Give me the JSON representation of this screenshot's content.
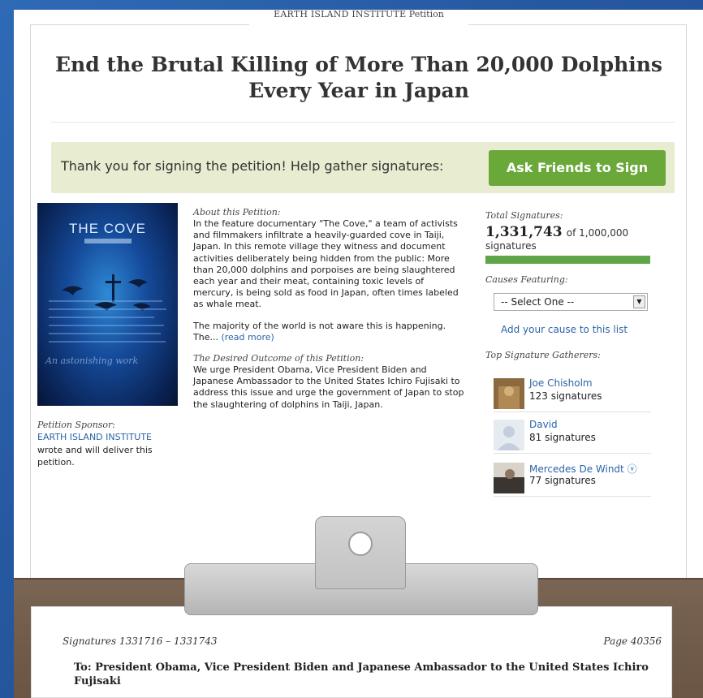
{
  "header": {
    "org": "EARTH ISLAND INSTITUTE",
    "suffix": "Petition"
  },
  "petition": {
    "title": "End the Brutal Killing of More Than 20,000 Dolphins Every Year in Japan",
    "thanks_text": "Thank you for signing the petition! Help gather signatures:",
    "ask_button": "Ask Friends to Sign",
    "poster_title": "THE COVE",
    "poster_tagline": "An astonishing work",
    "sponsor": {
      "label": "Petition Sponsor:",
      "name": "EARTH ISLAND INSTITUTE",
      "desc": "wrote and will deliver this petition."
    },
    "about": {
      "label": "About this Petition:",
      "text": "In the feature documentary \"The Cove,\" a team of activists and filmmakers infiltrate a heavily-guarded cove in Taiji, Japan. In this remote village they witness and document activities deliberately being hidden from the public: More than 20,000 dolphins and porpoises are being slaughtered each year and their meat, containing toxic levels of mercury, is being sold as food in Japan, often times labeled as whale meat.",
      "text2": "The majority of the world is not aware this is happening. The...",
      "read_more": "(read more)"
    },
    "outcome": {
      "label": "The Desired Outcome of this Petition:",
      "text": "We urge President Obama, Vice President Biden and Japanese Ambassador to the United States Ichiro Fujisaki to address this issue and urge the government of Japan to stop the slaughtering of dolphins in Taiji, Japan."
    }
  },
  "stats": {
    "total_label": "Total Signatures:",
    "total": "1,331,743",
    "of_text": "of 1,000,000",
    "signatures_word": "signatures",
    "progress_fraction": 1.0,
    "causes_label": "Causes Featuring:",
    "select_value": "-- Select One --",
    "add_cause": "Add your cause to this list",
    "gatherers_label": "Top Signature Gatherers:",
    "gatherers": [
      {
        "name": "Joe Chisholm",
        "count": "123 signatures"
      },
      {
        "name": "David",
        "count": "81 signatures"
      },
      {
        "name": "Mercedes De Windt ⓥ",
        "count": "77 signatures"
      }
    ]
  },
  "sheet": {
    "range": "Signatures 1331716 – 1331743",
    "page": "Page 40356",
    "to": "To: President Obama, Vice President Biden and Japanese Ambassador to the United States Ichiro Fujisaki"
  },
  "colors": {
    "accent_green": "#6aa83a",
    "link_blue": "#2b64a8",
    "thanks_bg": "#e8ecd0"
  }
}
